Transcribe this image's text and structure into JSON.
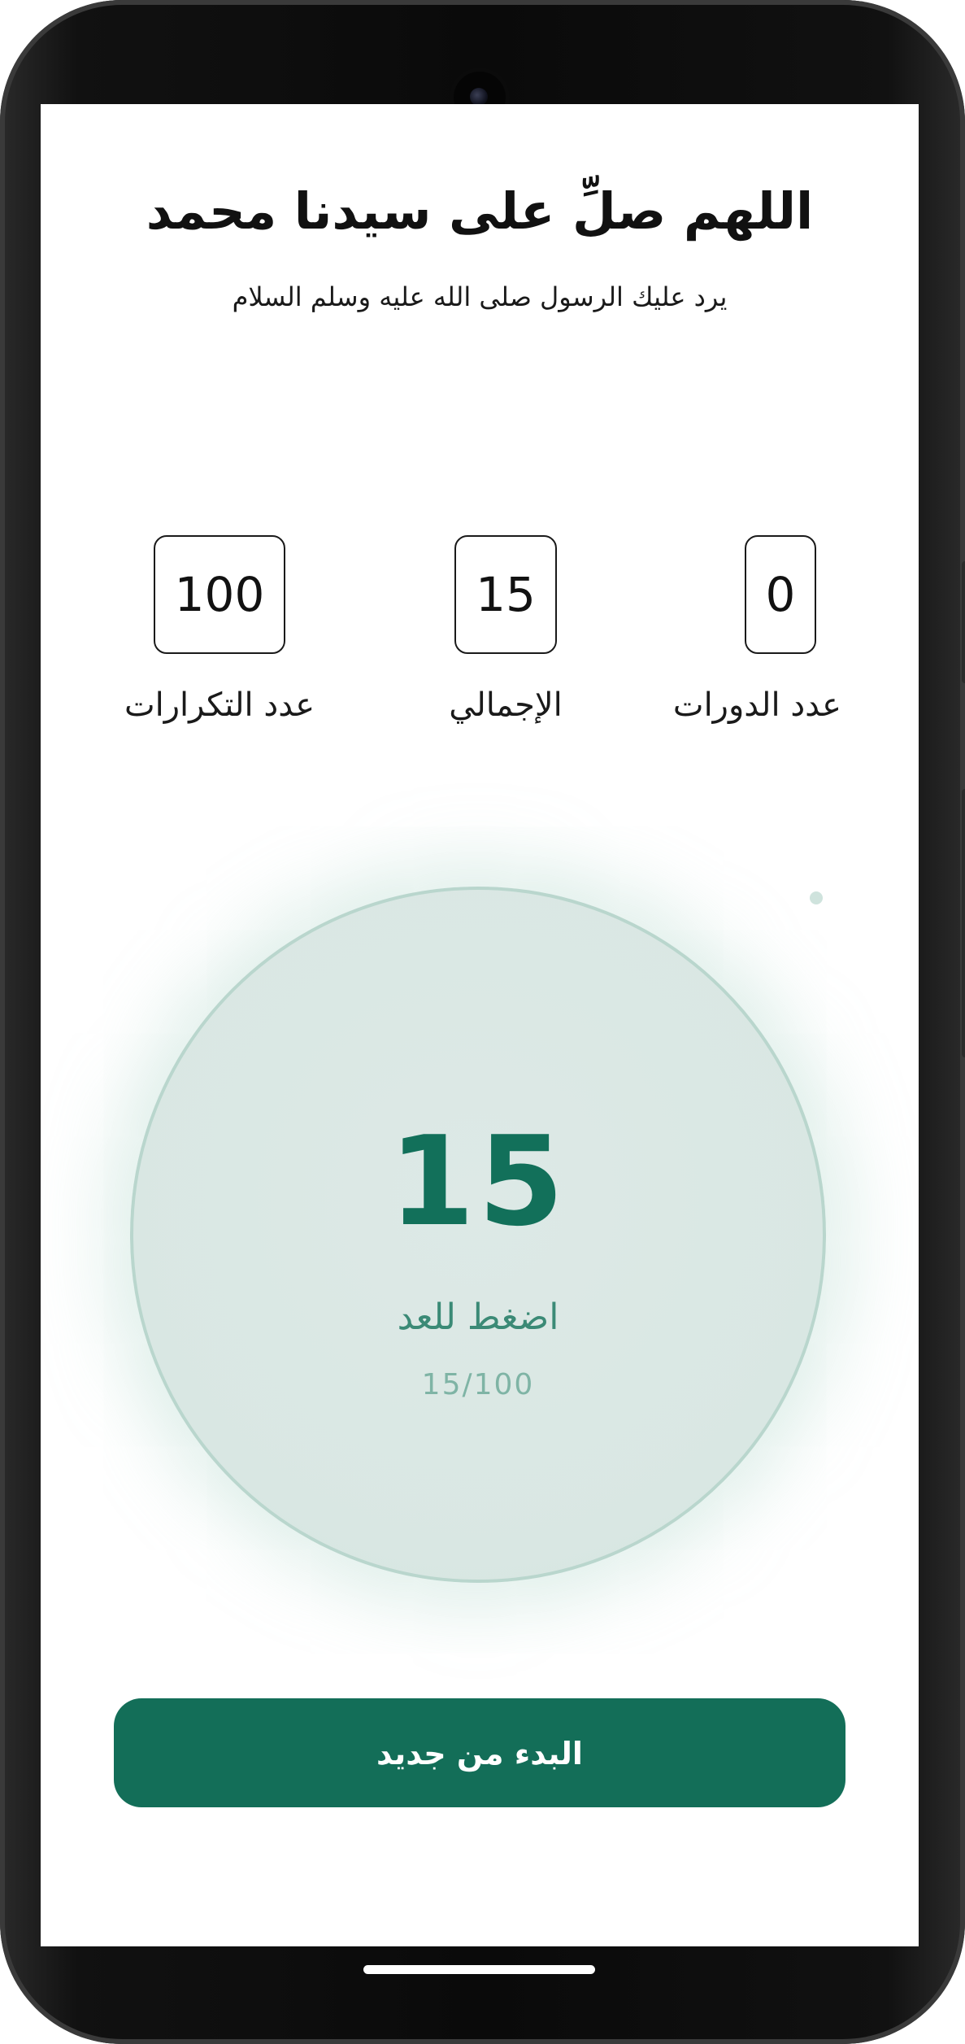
{
  "header": {
    "title": "اللهم صلِّ على سيدنا محمد",
    "subtitle": "يرد عليك الرسول صلى الله عليه وسلم السلام"
  },
  "stats": [
    {
      "value": "0",
      "label": "عدد الدورات"
    },
    {
      "value": "15",
      "label": "الإجمالي"
    },
    {
      "value": "100",
      "label": "عدد التكرارات"
    }
  ],
  "counter": {
    "value": "15",
    "hint": "اضغط للعد",
    "progress": "15/100",
    "progress_fraction": 0.15
  },
  "actions": {
    "reset_label": "البدء من جديد"
  },
  "colors": {
    "accent": "#136e58",
    "counter_text": "#12705a",
    "circle_fill": "#d9e7e3",
    "circle_border": "#b9d6cd"
  }
}
